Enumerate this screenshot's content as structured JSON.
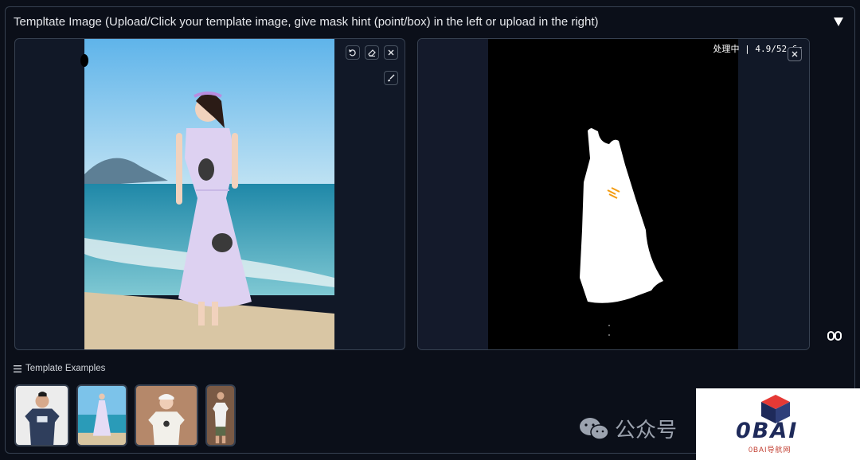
{
  "header": {
    "title": "Templtate Image (Upload/Click your template image, give mask hint (point/box) in the left or upload in the right)"
  },
  "left_image": {
    "tools": [
      "undo-icon",
      "eraser-icon",
      "close-icon",
      "brush-icon"
    ]
  },
  "right_image": {
    "progress_text": "处理中 | 4.9/52.6s",
    "tools": [
      "close-icon"
    ]
  },
  "examples": {
    "label": "Template Examples",
    "items": [
      "example-man-navy-tshirt",
      "example-woman-beach-dress",
      "example-woman-white-tshirt",
      "example-man-white-tshirt"
    ]
  },
  "watermark": {
    "wechat_text": "公众号",
    "logo_text": "0BAI",
    "logo_sub": "0BAI导航网"
  },
  "colors": {
    "background": "#0b0f19",
    "border": "#374151",
    "panel": "#111827",
    "logo_red": "#e53935",
    "logo_navy": "#1e2a5a"
  }
}
